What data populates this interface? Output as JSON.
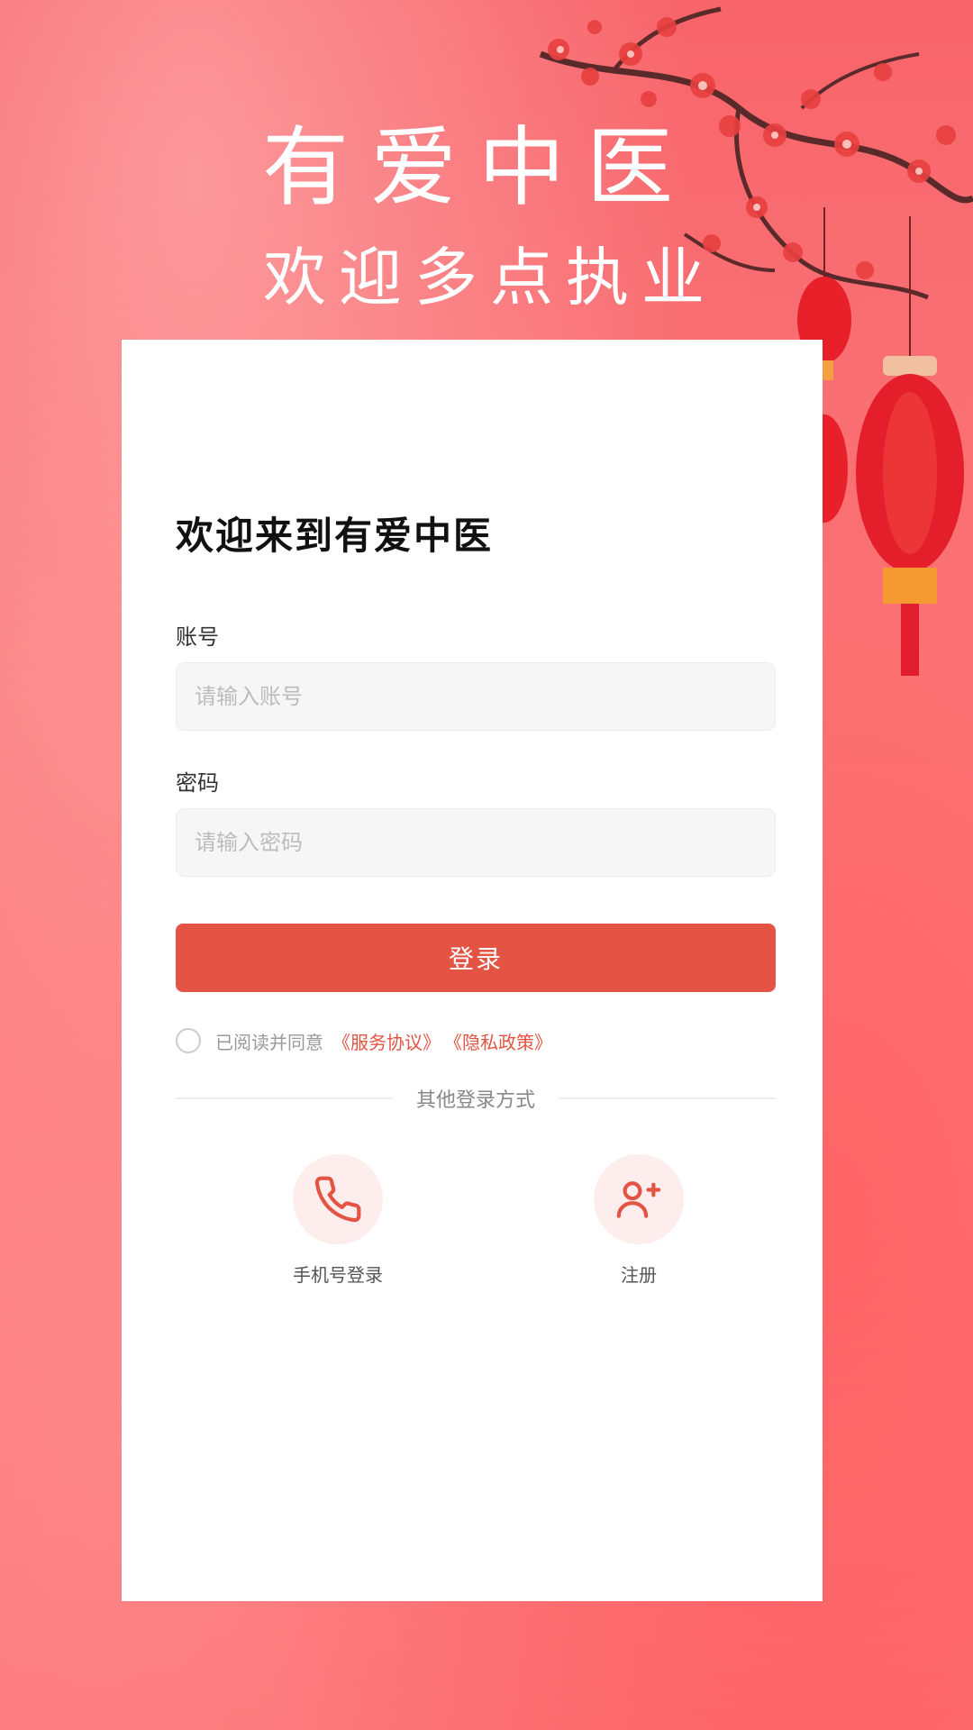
{
  "hero": {
    "title": "有爱中医",
    "subtitle": "欢迎多点执业"
  },
  "card": {
    "welcome": "欢迎来到有爱中医",
    "account_label": "账号",
    "account_placeholder": "请输入账号",
    "account_value": "",
    "password_label": "密码",
    "password_placeholder": "请输入密码",
    "password_value": "",
    "login_label": "登录",
    "agreement": {
      "prefix": "已阅读并同意",
      "service_link": "《服务协议》",
      "privacy_link": "《隐私政策》",
      "checked": false
    },
    "other_methods_label": "其他登录方式",
    "alt_methods": [
      {
        "label": "手机号登录",
        "icon": "phone-icon"
      },
      {
        "label": "注册",
        "icon": "add-user-icon"
      }
    ]
  },
  "colors": {
    "accent": "#e35445",
    "background": "#f96a6c",
    "icon_circle": "#fdeeed"
  }
}
